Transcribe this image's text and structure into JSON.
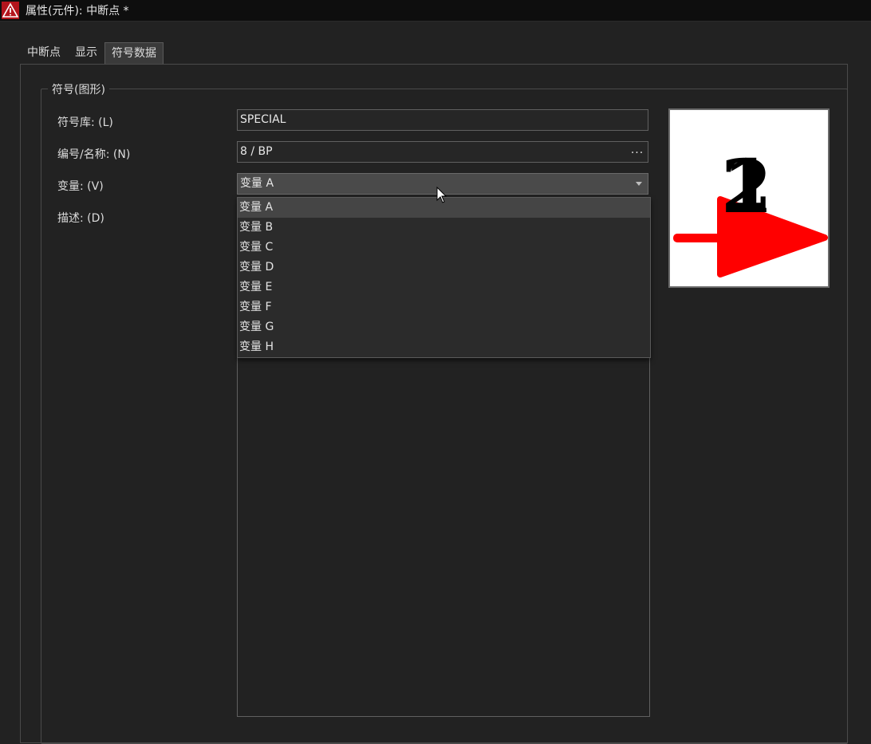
{
  "window": {
    "title": "属性(元件): 中断点 *"
  },
  "tabs": [
    {
      "label": "中断点",
      "active": false
    },
    {
      "label": "显示",
      "active": false
    },
    {
      "label": "符号数据",
      "active": true
    }
  ],
  "group": {
    "title": "符号(图形)",
    "fields": {
      "library": {
        "label": "符号库: (L)",
        "value": "SPECIAL"
      },
      "number_name": {
        "label": "编号/名称: (N)",
        "value": "8 / BP",
        "button": "..."
      },
      "variant": {
        "label": "变量: (V)",
        "value": "变量 A"
      },
      "description": {
        "label": "描述: (D)",
        "value": ""
      }
    }
  },
  "variant_options": [
    "变量 A",
    "变量 B",
    "变量 C",
    "变量 D",
    "变量 E",
    "变量 F",
    "变量 G",
    "变量 H"
  ],
  "selected_variant_index": 0,
  "preview": {
    "connection_digit_1": "1",
    "connection_digit_2": "2",
    "symbol_color": "#ff0000"
  },
  "colors": {
    "background": "#222222",
    "titlebar": "#0e0e0e",
    "accent": "#ff0000"
  }
}
